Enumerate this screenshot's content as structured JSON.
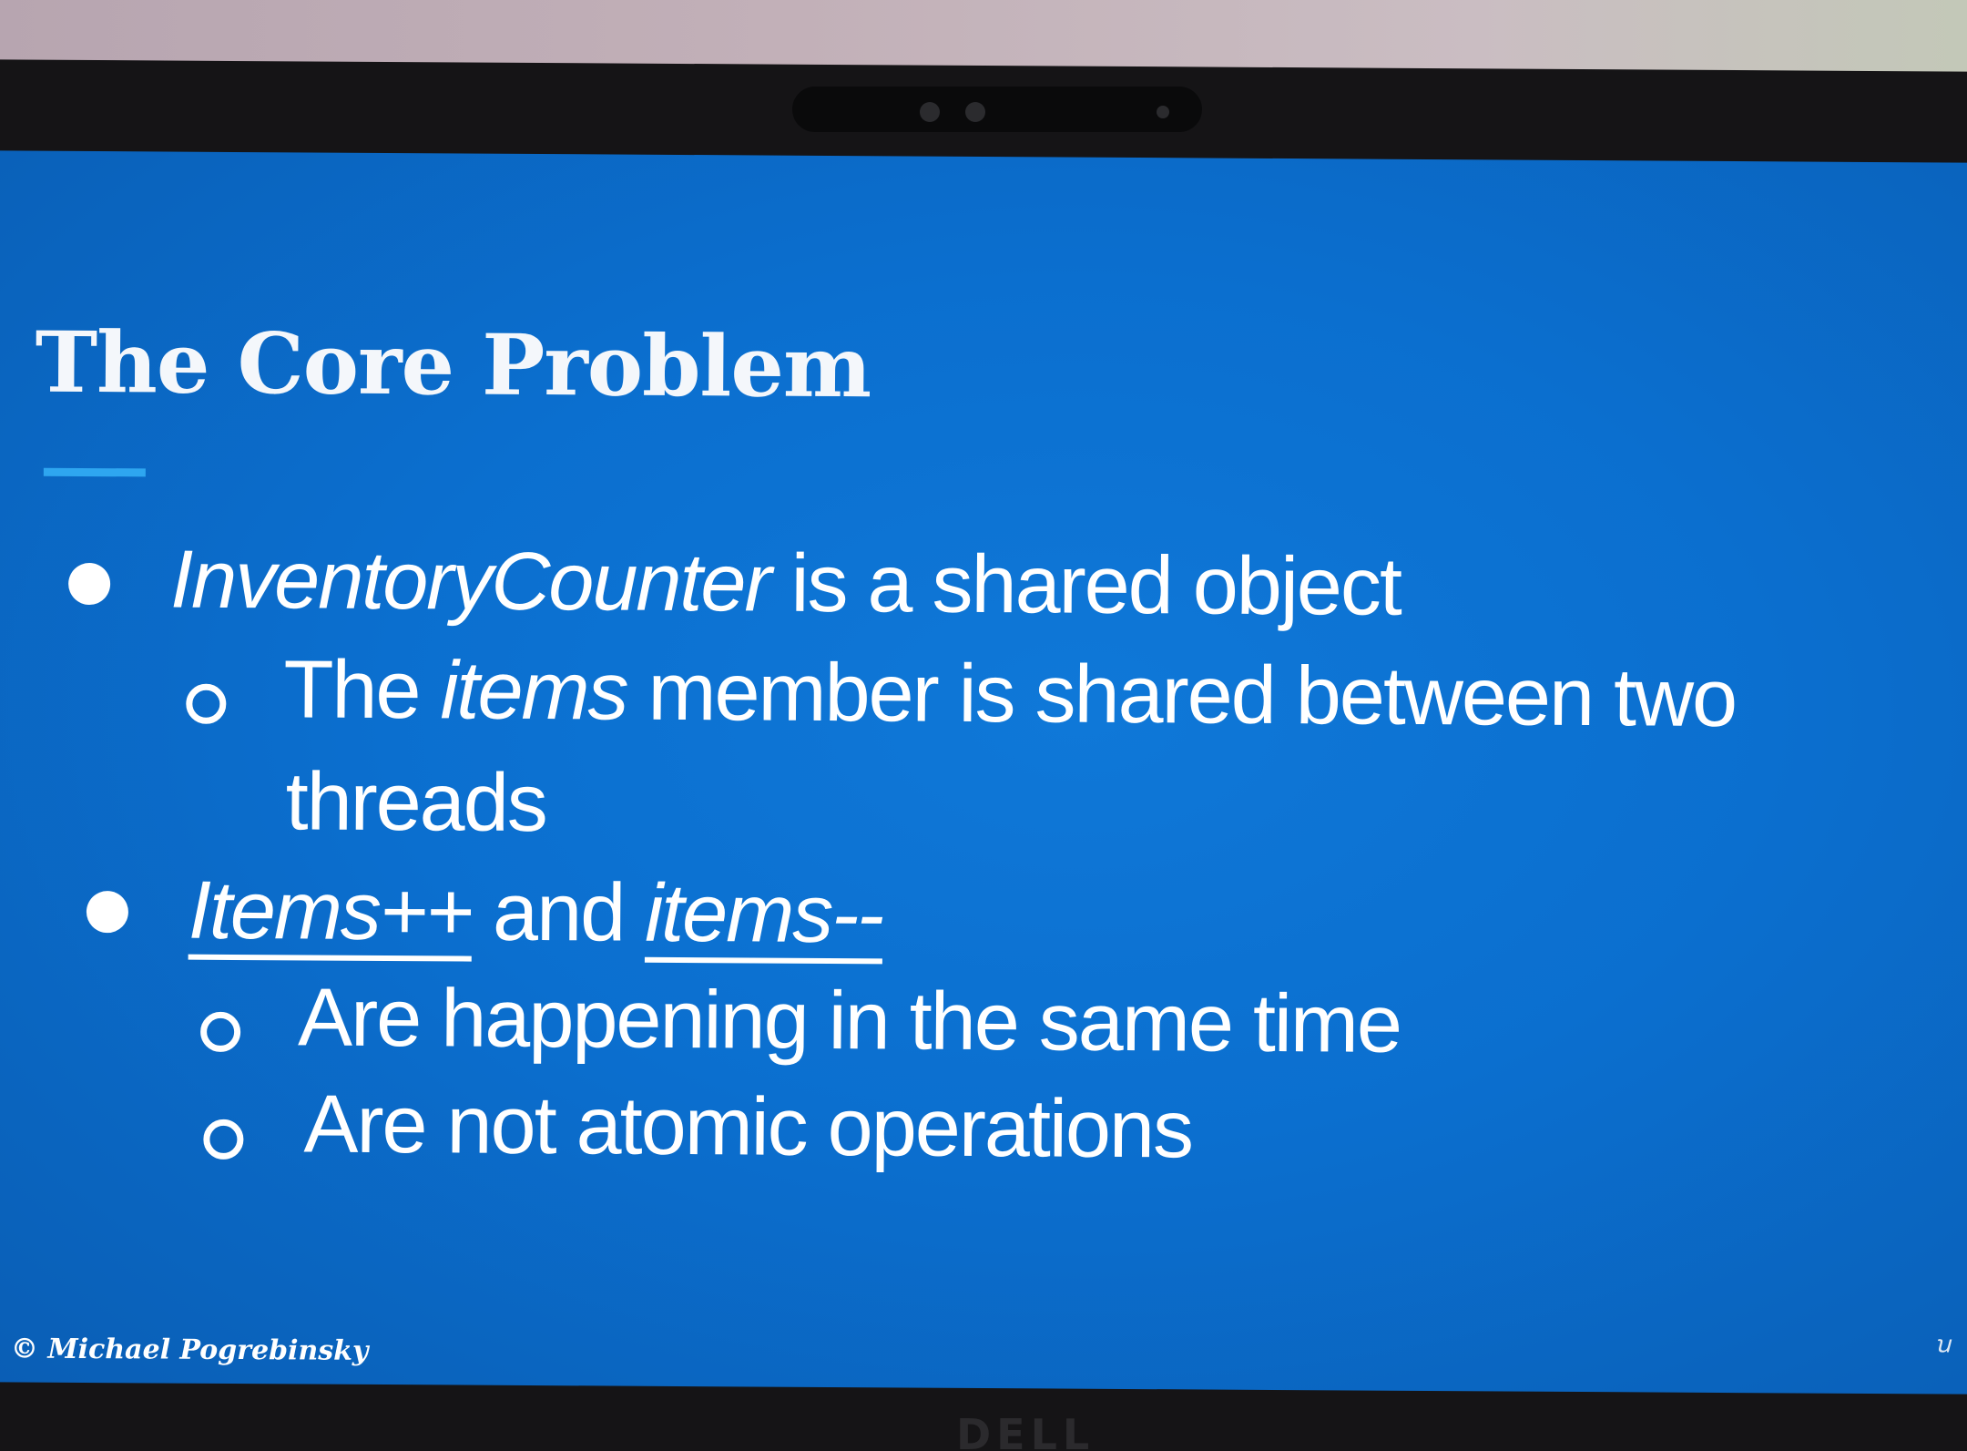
{
  "slide": {
    "title": "The Core Problem",
    "bullets": [
      {
        "level": 1,
        "segments": [
          {
            "text": "InventoryCounter",
            "style": "italic"
          },
          {
            "text": " is a shared object",
            "style": "normal"
          }
        ]
      },
      {
        "level": 2,
        "lines": [
          [
            {
              "text": "The ",
              "style": "normal"
            },
            {
              "text": "items",
              "style": "italic"
            },
            {
              "text": " member is shared between two",
              "style": "normal"
            }
          ],
          [
            {
              "text": "threads",
              "style": "normal"
            }
          ]
        ]
      },
      {
        "level": 1,
        "segments": [
          {
            "text": "Items++",
            "style": "italic-underline"
          },
          {
            "text": " and ",
            "style": "normal"
          },
          {
            "text": " items--",
            "style": "italic-underline"
          }
        ]
      },
      {
        "level": 2,
        "segments": [
          {
            "text": "Are happening in the same time",
            "style": "normal"
          }
        ]
      },
      {
        "level": 2,
        "segments": [
          {
            "text": "Are not atomic operations",
            "style": "normal"
          }
        ]
      }
    ],
    "footer": "© Michael Pogrebinsky"
  },
  "monitor": {
    "brand": "DELL"
  },
  "colors": {
    "slide_background": "#0b6fcf",
    "title_rule": "#2ea6f0",
    "text": "#ffffff"
  },
  "icons": {
    "level1_bullet": "filled-circle-icon",
    "level2_bullet": "hollow-circle-icon"
  }
}
